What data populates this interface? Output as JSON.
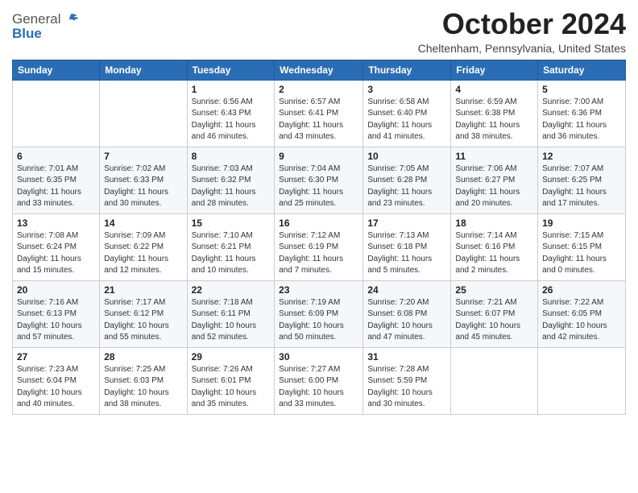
{
  "header": {
    "logo_general": "General",
    "logo_blue": "Blue",
    "month_title": "October 2024",
    "location": "Cheltenham, Pennsylvania, United States"
  },
  "weekdays": [
    "Sunday",
    "Monday",
    "Tuesday",
    "Wednesday",
    "Thursday",
    "Friday",
    "Saturday"
  ],
  "weeks": [
    [
      {
        "day": "",
        "sunrise": "",
        "sunset": "",
        "daylight": ""
      },
      {
        "day": "",
        "sunrise": "",
        "sunset": "",
        "daylight": ""
      },
      {
        "day": "1",
        "sunrise": "Sunrise: 6:56 AM",
        "sunset": "Sunset: 6:43 PM",
        "daylight": "Daylight: 11 hours and 46 minutes."
      },
      {
        "day": "2",
        "sunrise": "Sunrise: 6:57 AM",
        "sunset": "Sunset: 6:41 PM",
        "daylight": "Daylight: 11 hours and 43 minutes."
      },
      {
        "day": "3",
        "sunrise": "Sunrise: 6:58 AM",
        "sunset": "Sunset: 6:40 PM",
        "daylight": "Daylight: 11 hours and 41 minutes."
      },
      {
        "day": "4",
        "sunrise": "Sunrise: 6:59 AM",
        "sunset": "Sunset: 6:38 PM",
        "daylight": "Daylight: 11 hours and 38 minutes."
      },
      {
        "day": "5",
        "sunrise": "Sunrise: 7:00 AM",
        "sunset": "Sunset: 6:36 PM",
        "daylight": "Daylight: 11 hours and 36 minutes."
      }
    ],
    [
      {
        "day": "6",
        "sunrise": "Sunrise: 7:01 AM",
        "sunset": "Sunset: 6:35 PM",
        "daylight": "Daylight: 11 hours and 33 minutes."
      },
      {
        "day": "7",
        "sunrise": "Sunrise: 7:02 AM",
        "sunset": "Sunset: 6:33 PM",
        "daylight": "Daylight: 11 hours and 30 minutes."
      },
      {
        "day": "8",
        "sunrise": "Sunrise: 7:03 AM",
        "sunset": "Sunset: 6:32 PM",
        "daylight": "Daylight: 11 hours and 28 minutes."
      },
      {
        "day": "9",
        "sunrise": "Sunrise: 7:04 AM",
        "sunset": "Sunset: 6:30 PM",
        "daylight": "Daylight: 11 hours and 25 minutes."
      },
      {
        "day": "10",
        "sunrise": "Sunrise: 7:05 AM",
        "sunset": "Sunset: 6:28 PM",
        "daylight": "Daylight: 11 hours and 23 minutes."
      },
      {
        "day": "11",
        "sunrise": "Sunrise: 7:06 AM",
        "sunset": "Sunset: 6:27 PM",
        "daylight": "Daylight: 11 hours and 20 minutes."
      },
      {
        "day": "12",
        "sunrise": "Sunrise: 7:07 AM",
        "sunset": "Sunset: 6:25 PM",
        "daylight": "Daylight: 11 hours and 17 minutes."
      }
    ],
    [
      {
        "day": "13",
        "sunrise": "Sunrise: 7:08 AM",
        "sunset": "Sunset: 6:24 PM",
        "daylight": "Daylight: 11 hours and 15 minutes."
      },
      {
        "day": "14",
        "sunrise": "Sunrise: 7:09 AM",
        "sunset": "Sunset: 6:22 PM",
        "daylight": "Daylight: 11 hours and 12 minutes."
      },
      {
        "day": "15",
        "sunrise": "Sunrise: 7:10 AM",
        "sunset": "Sunset: 6:21 PM",
        "daylight": "Daylight: 11 hours and 10 minutes."
      },
      {
        "day": "16",
        "sunrise": "Sunrise: 7:12 AM",
        "sunset": "Sunset: 6:19 PM",
        "daylight": "Daylight: 11 hours and 7 minutes."
      },
      {
        "day": "17",
        "sunrise": "Sunrise: 7:13 AM",
        "sunset": "Sunset: 6:18 PM",
        "daylight": "Daylight: 11 hours and 5 minutes."
      },
      {
        "day": "18",
        "sunrise": "Sunrise: 7:14 AM",
        "sunset": "Sunset: 6:16 PM",
        "daylight": "Daylight: 11 hours and 2 minutes."
      },
      {
        "day": "19",
        "sunrise": "Sunrise: 7:15 AM",
        "sunset": "Sunset: 6:15 PM",
        "daylight": "Daylight: 11 hours and 0 minutes."
      }
    ],
    [
      {
        "day": "20",
        "sunrise": "Sunrise: 7:16 AM",
        "sunset": "Sunset: 6:13 PM",
        "daylight": "Daylight: 10 hours and 57 minutes."
      },
      {
        "day": "21",
        "sunrise": "Sunrise: 7:17 AM",
        "sunset": "Sunset: 6:12 PM",
        "daylight": "Daylight: 10 hours and 55 minutes."
      },
      {
        "day": "22",
        "sunrise": "Sunrise: 7:18 AM",
        "sunset": "Sunset: 6:11 PM",
        "daylight": "Daylight: 10 hours and 52 minutes."
      },
      {
        "day": "23",
        "sunrise": "Sunrise: 7:19 AM",
        "sunset": "Sunset: 6:09 PM",
        "daylight": "Daylight: 10 hours and 50 minutes."
      },
      {
        "day": "24",
        "sunrise": "Sunrise: 7:20 AM",
        "sunset": "Sunset: 6:08 PM",
        "daylight": "Daylight: 10 hours and 47 minutes."
      },
      {
        "day": "25",
        "sunrise": "Sunrise: 7:21 AM",
        "sunset": "Sunset: 6:07 PM",
        "daylight": "Daylight: 10 hours and 45 minutes."
      },
      {
        "day": "26",
        "sunrise": "Sunrise: 7:22 AM",
        "sunset": "Sunset: 6:05 PM",
        "daylight": "Daylight: 10 hours and 42 minutes."
      }
    ],
    [
      {
        "day": "27",
        "sunrise": "Sunrise: 7:23 AM",
        "sunset": "Sunset: 6:04 PM",
        "daylight": "Daylight: 10 hours and 40 minutes."
      },
      {
        "day": "28",
        "sunrise": "Sunrise: 7:25 AM",
        "sunset": "Sunset: 6:03 PM",
        "daylight": "Daylight: 10 hours and 38 minutes."
      },
      {
        "day": "29",
        "sunrise": "Sunrise: 7:26 AM",
        "sunset": "Sunset: 6:01 PM",
        "daylight": "Daylight: 10 hours and 35 minutes."
      },
      {
        "day": "30",
        "sunrise": "Sunrise: 7:27 AM",
        "sunset": "Sunset: 6:00 PM",
        "daylight": "Daylight: 10 hours and 33 minutes."
      },
      {
        "day": "31",
        "sunrise": "Sunrise: 7:28 AM",
        "sunset": "Sunset: 5:59 PM",
        "daylight": "Daylight: 10 hours and 30 minutes."
      },
      {
        "day": "",
        "sunrise": "",
        "sunset": "",
        "daylight": ""
      },
      {
        "day": "",
        "sunrise": "",
        "sunset": "",
        "daylight": ""
      }
    ]
  ]
}
